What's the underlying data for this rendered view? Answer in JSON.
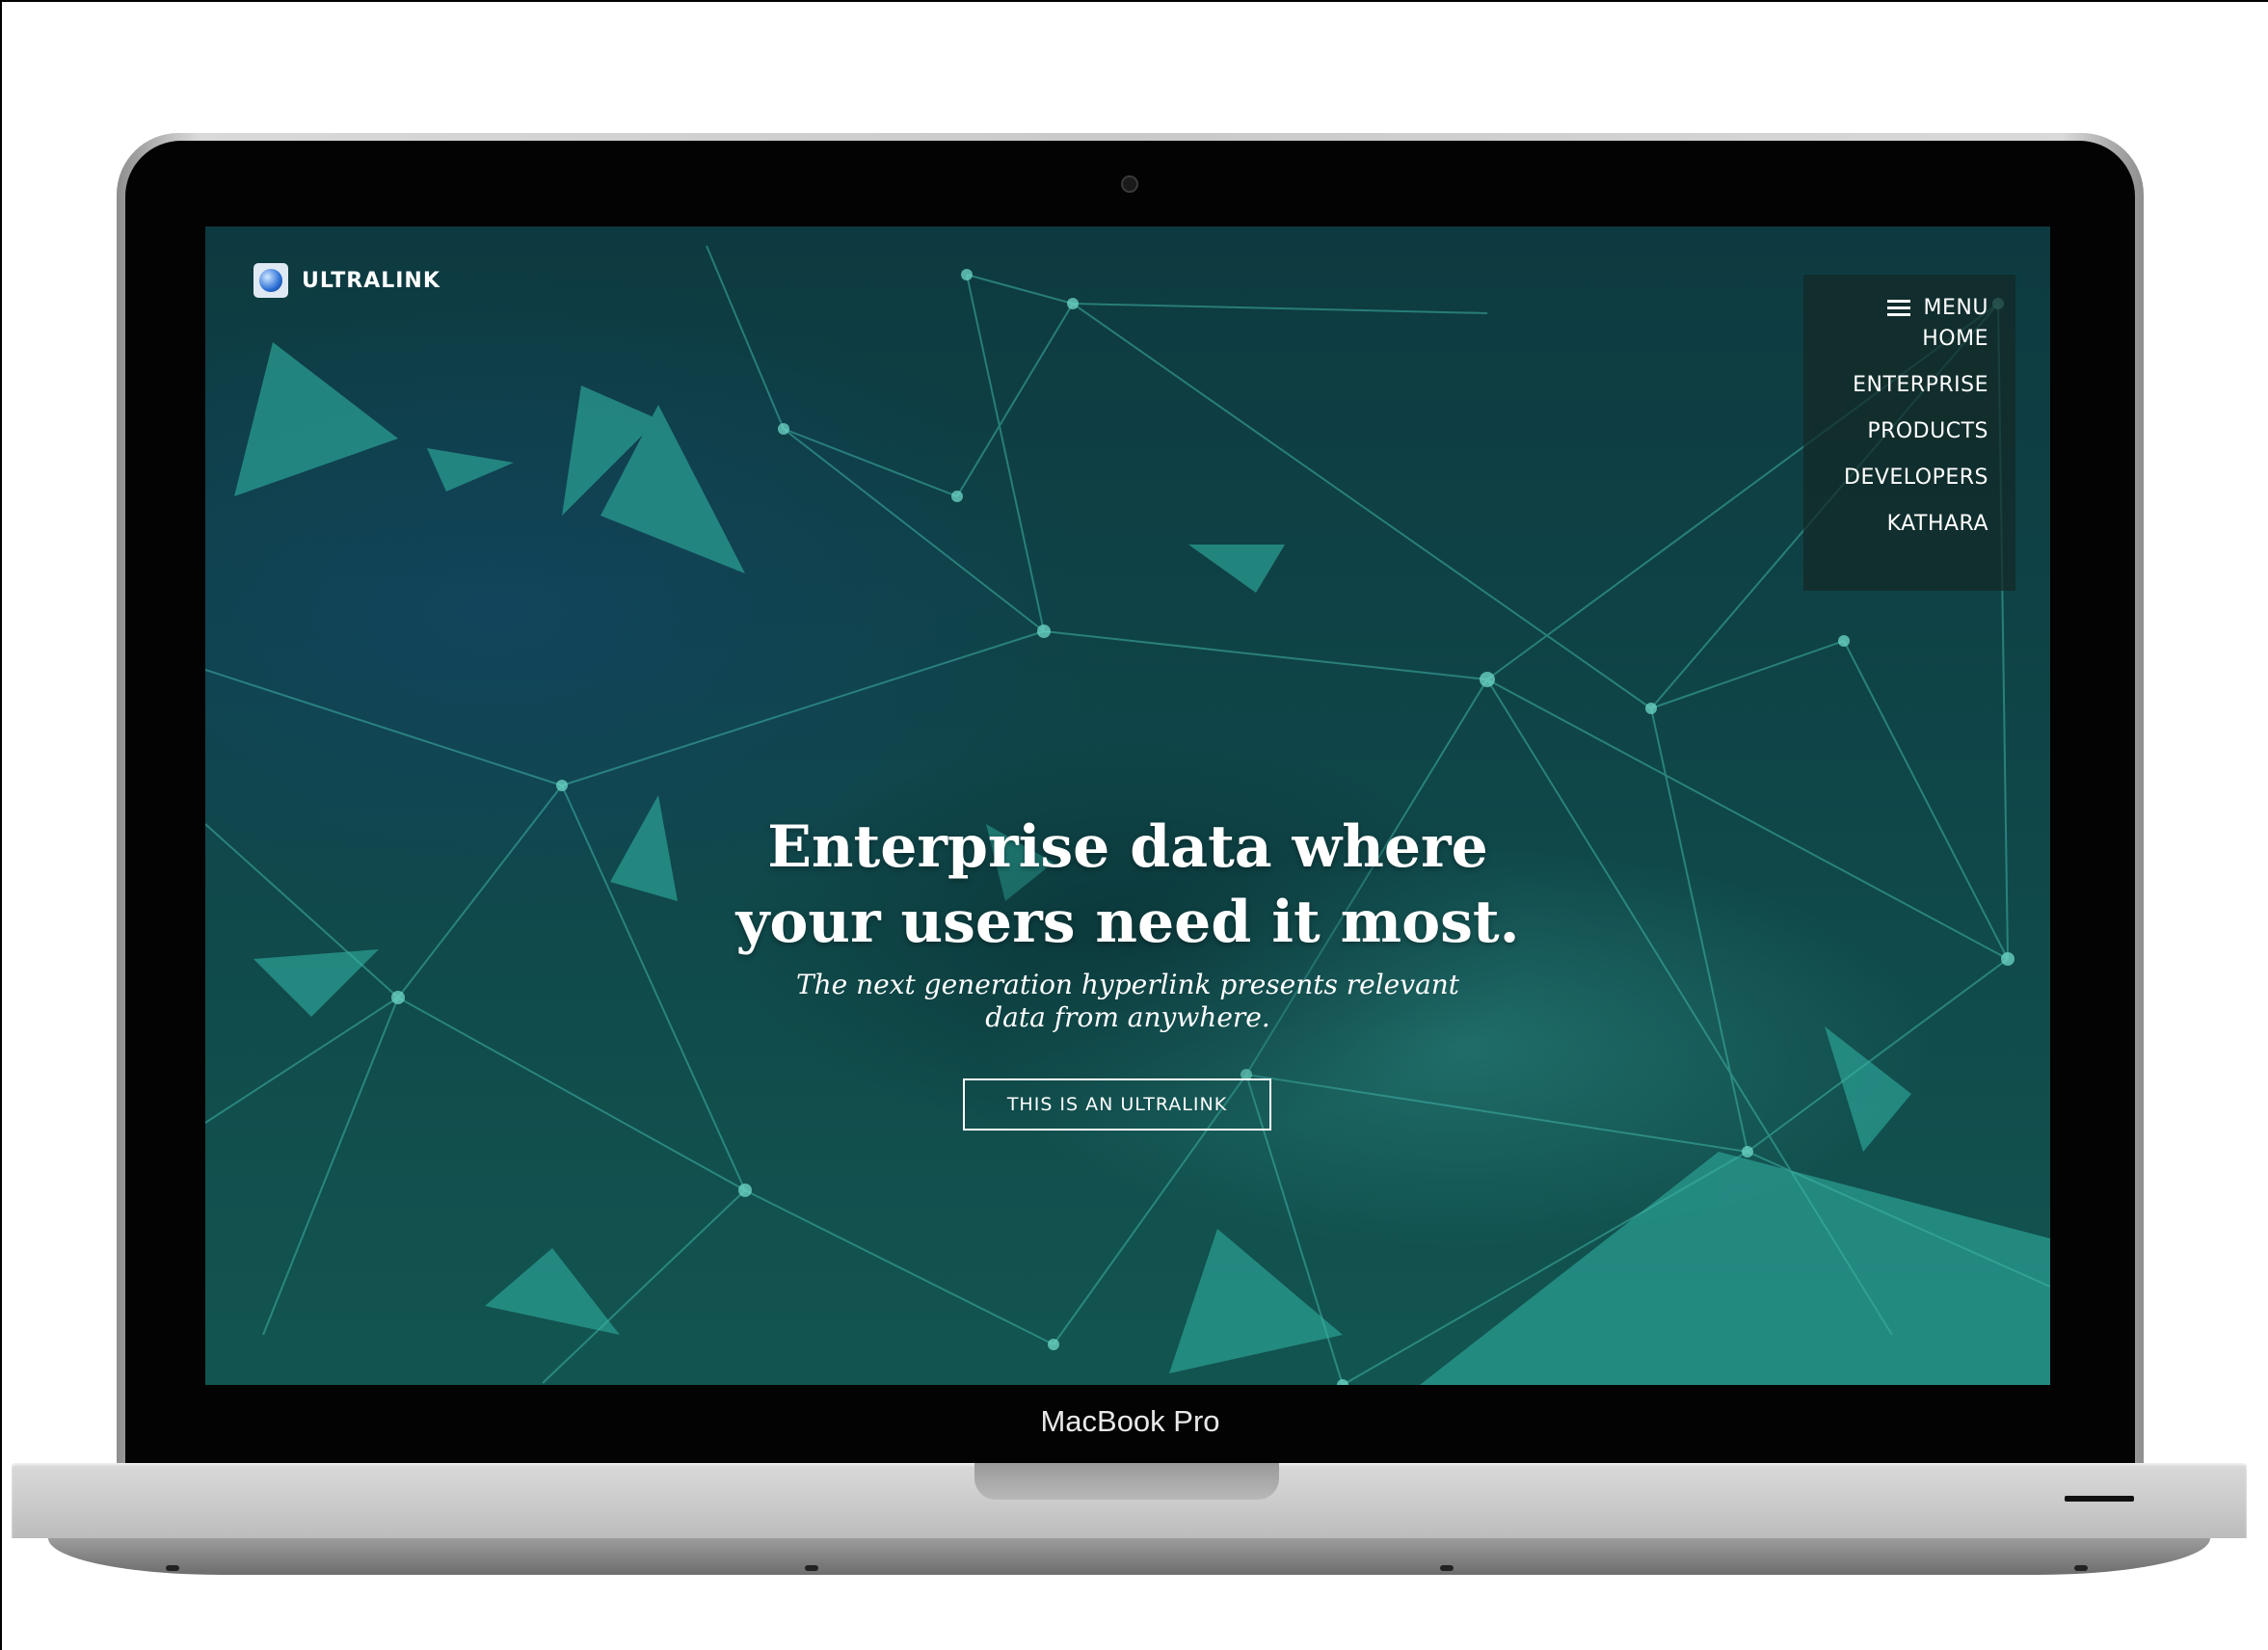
{
  "device": {
    "model_label": "MacBook Pro"
  },
  "site": {
    "brand": {
      "name": "ULTRALINK",
      "logo_icon": "ultralink-globe-icon"
    },
    "menu": {
      "toggle_label": "MENU",
      "items": [
        {
          "label": "HOME"
        },
        {
          "label": "ENTERPRISE"
        },
        {
          "label": "PRODUCTS"
        },
        {
          "label": "DEVELOPERS"
        },
        {
          "label": "KATHARA"
        }
      ]
    },
    "hero": {
      "title_line1": "Enterprise data where",
      "title_line2": "your users need it most.",
      "subtitle_line1": "The next generation hyperlink presents relevant",
      "subtitle_line2": "data from anywhere.",
      "cta_label": "THIS IS AN ULTRALINK"
    }
  },
  "colors": {
    "screen_background": "#0f4548",
    "network_line": "#3fb3a6",
    "network_shard": "#2a9c90",
    "menu_panel": "#142826"
  }
}
